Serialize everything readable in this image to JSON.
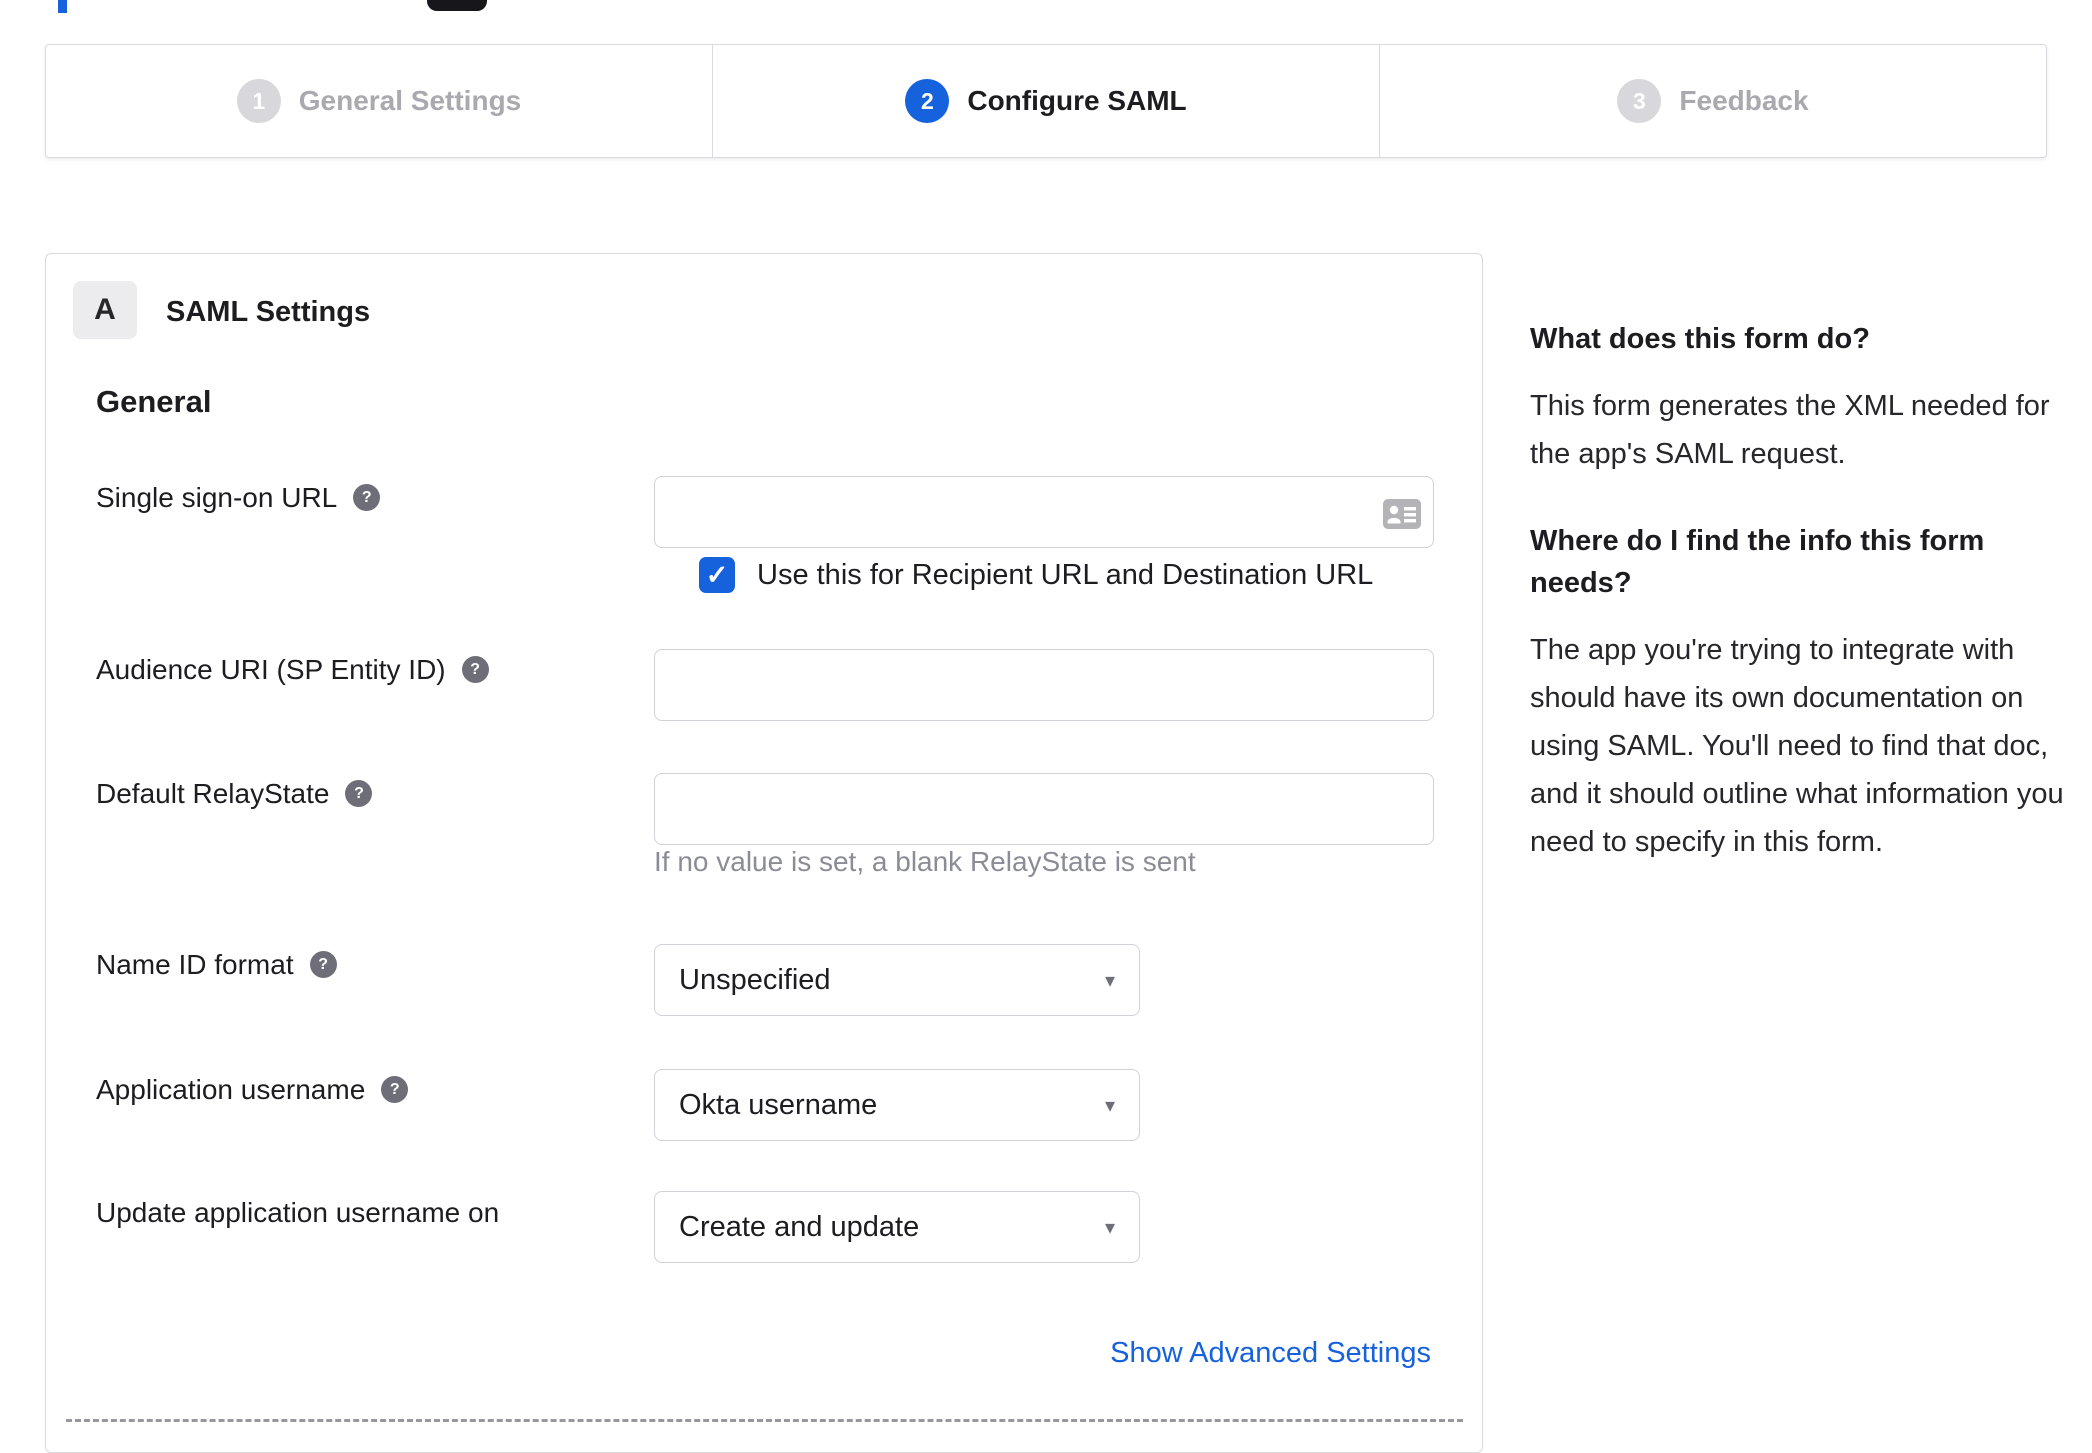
{
  "colors": {
    "accent": "#1662dd",
    "inactive_gray": "#d7d7dc"
  },
  "stepper": {
    "steps": [
      {
        "number": "1",
        "label": "General Settings",
        "state": "inactive"
      },
      {
        "number": "2",
        "label": "Configure SAML",
        "state": "active"
      },
      {
        "number": "3",
        "label": "Feedback",
        "state": "inactive"
      }
    ]
  },
  "form": {
    "section_badge": "A",
    "section_title": "SAML Settings",
    "group_title": "General",
    "fields": [
      {
        "label": "Single sign-on URL",
        "type": "text",
        "value": "",
        "checkbox_label": "Use this for Recipient URL and Destination URL",
        "checkbox_checked": true
      },
      {
        "label": "Audience URI (SP Entity ID)",
        "type": "text",
        "value": ""
      },
      {
        "label": "Default RelayState",
        "type": "text",
        "value": "",
        "helper": "If no value is set, a blank RelayState is sent"
      },
      {
        "label": "Name ID format",
        "type": "select",
        "value": "Unspecified"
      },
      {
        "label": "Application username",
        "type": "select",
        "value": "Okta username"
      },
      {
        "label": "Update application username on",
        "type": "select",
        "value": "Create and update"
      }
    ],
    "advanced_link": "Show Advanced Settings",
    "checkmark": "✓",
    "dropdown_arrow": "▾"
  },
  "sidebar": {
    "sections": [
      {
        "heading": "What does this form do?",
        "body": "This form generates the XML needed for the app's SAML request."
      },
      {
        "heading": "Where do I find the info this form needs?",
        "body": "The app you're trying to integrate with should have its own documentation on using SAML. You'll need to find that doc, and it should outline what information you need to specify in this form."
      }
    ]
  }
}
